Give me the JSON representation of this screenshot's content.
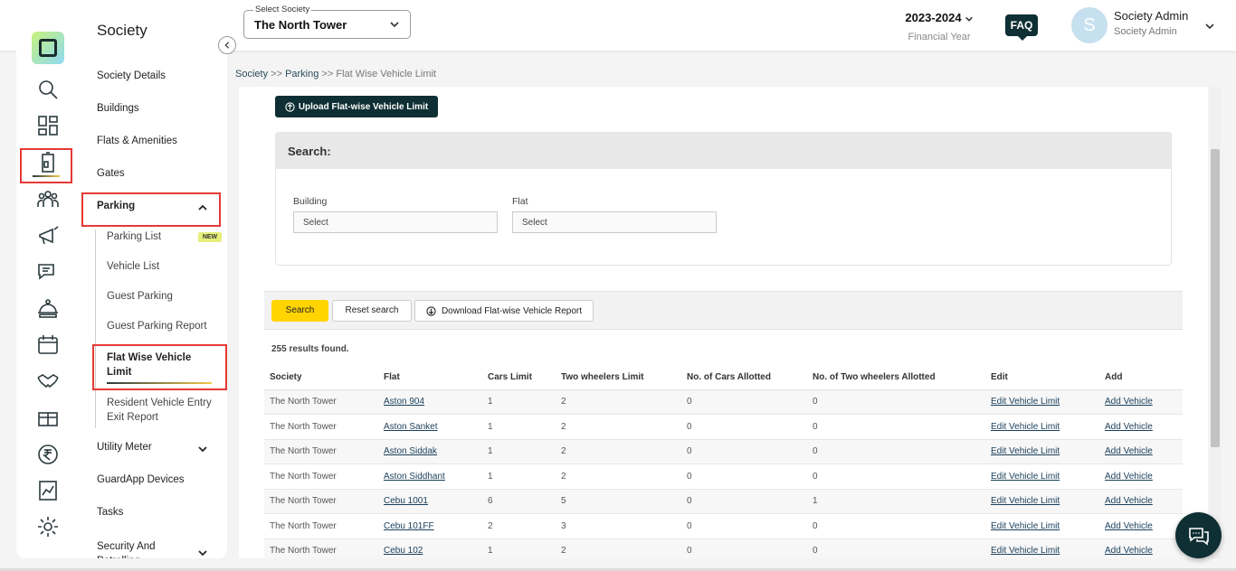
{
  "header": {
    "society_select_label": "Select Society",
    "society_value": "The North Tower",
    "financial_year": "2023-2024",
    "financial_year_label": "Financial Year",
    "faq": "FAQ",
    "avatar_letter": "S",
    "user_name": "Society Admin",
    "user_role": "Society Admin"
  },
  "rail": {
    "icons": [
      "search-icon",
      "dashboard-icon",
      "building-icon",
      "people-icon",
      "megaphone-icon",
      "chat-icon",
      "service-icon",
      "calendar-icon",
      "handshake-icon",
      "gift-icon",
      "rupee-icon",
      "chart-icon",
      "settings-icon"
    ],
    "active": "building-icon"
  },
  "sidebar": {
    "title": "Society",
    "items": [
      {
        "label": "Society Details"
      },
      {
        "label": "Buildings"
      },
      {
        "label": "Flats & Amenities"
      },
      {
        "label": "Gates"
      },
      {
        "label": "Parking"
      },
      {
        "label": "Utility Meter"
      },
      {
        "label": "GuardApp Devices"
      },
      {
        "label": "Tasks"
      },
      {
        "label": "Security And Patrolling"
      }
    ],
    "parking_sub": [
      {
        "label": "Parking List",
        "badge": "NEW"
      },
      {
        "label": "Vehicle List"
      },
      {
        "label": "Guest Parking"
      },
      {
        "label": "Guest Parking Report"
      },
      {
        "label": "Flat Wise Vehicle Limit"
      },
      {
        "label": "Resident Vehicle Entry Exit Report"
      }
    ]
  },
  "breadcrumb": {
    "society": "Society",
    "sep1": ">>",
    "parking": "Parking",
    "sep2": ">>",
    "current": "Flat Wise Vehicle Limit"
  },
  "main": {
    "upload_button": "Upload Flat-wise Vehicle Limit",
    "search_title": "Search:",
    "building_label": "Building",
    "building_value": "Select",
    "flat_label": "Flat",
    "flat_value": "Select",
    "search_button": "Search",
    "reset_button": "Reset search",
    "download_button": "Download Flat-wise Vehicle Report",
    "results": "255 results found."
  },
  "table": {
    "columns": [
      "Society",
      "Flat",
      "Cars Limit",
      "Two wheelers Limit",
      "No. of Cars Allotted",
      "No. of Two wheelers Allotted",
      "Edit",
      "Add"
    ],
    "rows": [
      [
        "The North Tower",
        "Aston 904",
        "1",
        "2",
        "0",
        "0",
        "Edit Vehicle Limit",
        "Add Vehicle"
      ],
      [
        "The North Tower",
        "Aston Sanket",
        "1",
        "2",
        "0",
        "0",
        "Edit Vehicle Limit",
        "Add Vehicle"
      ],
      [
        "The North Tower",
        "Aston Siddak",
        "1",
        "2",
        "0",
        "0",
        "Edit Vehicle Limit",
        "Add Vehicle"
      ],
      [
        "The North Tower",
        "Aston Siddhant",
        "1",
        "2",
        "0",
        "0",
        "Edit Vehicle Limit",
        "Add Vehicle"
      ],
      [
        "The North Tower",
        "Cebu 1001",
        "6",
        "5",
        "0",
        "1",
        "Edit Vehicle Limit",
        "Add Vehicle"
      ],
      [
        "The North Tower",
        "Cebu 101FF",
        "2",
        "3",
        "0",
        "0",
        "Edit Vehicle Limit",
        "Add Vehicle"
      ],
      [
        "The North Tower",
        "Cebu 102",
        "1",
        "2",
        "0",
        "0",
        "Edit Vehicle Limit",
        "Add Vehicle"
      ]
    ]
  },
  "colors": {
    "brand_dark": "#0e2f33",
    "accent_yellow": "#ffd400",
    "highlight_red": "#e53935"
  }
}
